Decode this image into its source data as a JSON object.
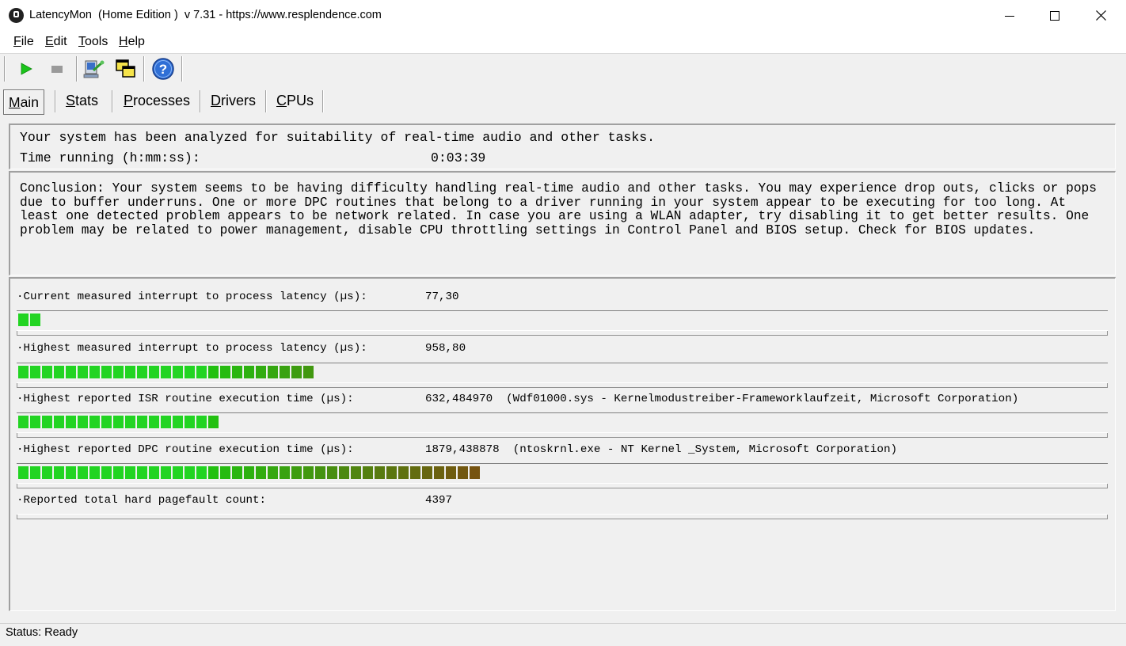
{
  "window": {
    "title": "LatencyMon  (Home Edition )  v 7.31 - https://www.resplendence.com"
  },
  "menu": [
    {
      "label": "File",
      "accel": "F",
      "rest": "ile"
    },
    {
      "label": "Edit",
      "accel": "E",
      "rest": "dit"
    },
    {
      "label": "Tools",
      "accel": "T",
      "rest": "ools"
    },
    {
      "label": "Help",
      "accel": "H",
      "rest": "elp"
    }
  ],
  "toolbar": {
    "icons": [
      "start-monitor-icon",
      "stop-monitor-icon",
      "analyze-icon",
      "windows-icon",
      "help-icon"
    ]
  },
  "tabs": [
    {
      "label": "Main",
      "accel": "M",
      "rest": "ain",
      "active": true
    },
    {
      "label": "Stats",
      "accel": "S",
      "rest": "tats",
      "active": false
    },
    {
      "label": "Processes",
      "accel": "P",
      "rest": "rocesses",
      "active": false
    },
    {
      "label": "Drivers",
      "accel": "D",
      "rest": "rivers",
      "active": false
    },
    {
      "label": "CPUs",
      "accel": "C",
      "rest": "PUs",
      "active": false
    }
  ],
  "summary": {
    "line1": "Your system has been analyzed for suitability of real-time audio and other tasks.",
    "time_label": "Time running (h:mm:ss):",
    "time_value": "0:03:39"
  },
  "conclusion": "Conclusion: Your system seems to be having difficulty handling real-time audio and other tasks. You may experience drop outs, clicks or pops due to buffer underruns. One or more DPC routines that belong to a driver running in your system appear to be executing for too long. At least one detected problem appears to be network related. In case you are using a WLAN adapter, try disabling it to get better results. One problem may be related to power management, disable CPU throttling settings in Control Panel and BIOS setup. Check for BIOS updates.",
  "metrics": [
    {
      "label": "·Current measured interrupt to process latency (µs):",
      "value": "77,30",
      "extra": "",
      "bar_segments": 2
    },
    {
      "label": "·Highest measured interrupt to process latency (µs):",
      "value": "958,80",
      "extra": "",
      "bar_segments": 25
    },
    {
      "label": "·Highest reported ISR routine execution time (µs):",
      "value": "632,484970",
      "extra": "(Wdf01000.sys - Kernelmodustreiber-Frameworklaufzeit, Microsoft Corporation)",
      "bar_segments": 17
    },
    {
      "label": "·Highest reported DPC routine execution time (µs):",
      "value": "1879,438878",
      "extra": "(ntoskrnl.exe - NT Kernel _System, Microsoft Corporation)",
      "bar_segments": 39
    },
    {
      "label": "·Reported total hard pagefault count:",
      "value": "4397",
      "extra": "",
      "bar_segments": 0
    }
  ],
  "status": {
    "text": "Status: Ready"
  }
}
